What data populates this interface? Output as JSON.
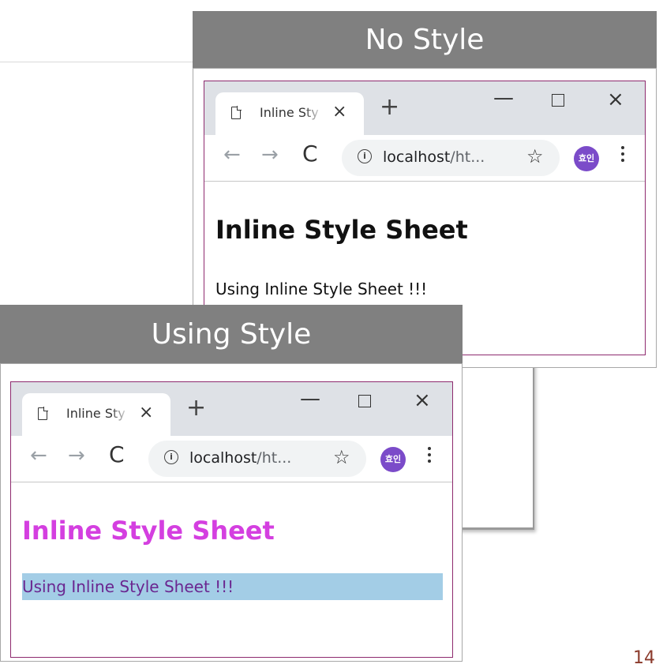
{
  "labels": {
    "no_style": "No Style",
    "using_style": "Using Style"
  },
  "browser_top": {
    "tab_title": "Inline Sty",
    "tab_close": "×",
    "new_tab": "+",
    "min": "—",
    "close": "×",
    "back": "←",
    "forward": "→",
    "reload": "C",
    "url_host": "localhost",
    "url_rest": "/ht...",
    "star": "☆",
    "avatar": "효인",
    "heading": "Inline Style Sheet",
    "paragraph": "Using Inline Style Sheet !!!"
  },
  "browser_bottom": {
    "tab_title": "Inline Sty",
    "tab_close": "×",
    "new_tab": "+",
    "min": "—",
    "close": "×",
    "back": "←",
    "forward": "→",
    "reload": "C",
    "url_host": "localhost",
    "url_rest": "/ht...",
    "star": "☆",
    "avatar": "효인",
    "heading": "Inline Style Sheet",
    "paragraph": "Using Inline Style Sheet !!!",
    "heading_color": "#d43fe0",
    "paragraph_bg": "#a3cde6",
    "paragraph_color": "#6a2690"
  },
  "page_number": "14"
}
